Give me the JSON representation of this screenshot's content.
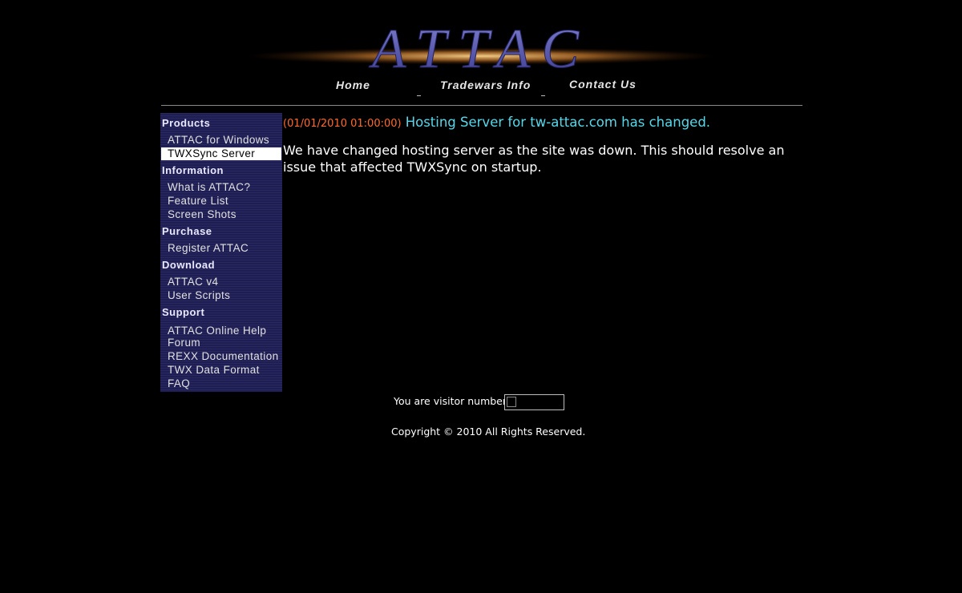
{
  "header": {
    "logo_text": "ATTAC"
  },
  "nav": {
    "home": "Home",
    "tradewars": "Tradewars Info",
    "contact": "Contact Us"
  },
  "sidebar": {
    "sections": [
      {
        "heading": "Products",
        "items": [
          {
            "label": "ATTAC for Windows",
            "active": false
          },
          {
            "label": "TWXSync Server",
            "active": true
          }
        ]
      },
      {
        "heading": "Information",
        "items": [
          {
            "label": "What is ATTAC?"
          },
          {
            "label": "Feature List"
          },
          {
            "label": "Screen Shots"
          }
        ]
      },
      {
        "heading": "Purchase",
        "items": [
          {
            "label": "Register ATTAC"
          }
        ]
      },
      {
        "heading": "Download",
        "items": [
          {
            "label": "ATTAC v4"
          },
          {
            "label": "User Scripts"
          }
        ]
      },
      {
        "heading": "Support",
        "items": [
          {
            "label": "ATTAC Online Help"
          },
          {
            "label": "Forum"
          },
          {
            "label": "REXX Documentation"
          },
          {
            "label": "TWX Data Format"
          },
          {
            "label": "FAQ"
          }
        ]
      }
    ]
  },
  "news": {
    "date": "(01/01/2010 01:00:00)",
    "title": "Hosting Server for tw-attac.com has changed.",
    "body": "We have changed hosting server as the site was down. This should resolve an issue that affected TWXSync on startup."
  },
  "footer": {
    "visitor_label": "You are visitor number",
    "copyright": "Copyright © 2010  All Rights Reserved."
  },
  "colors": {
    "background": "#000000",
    "sidebar_bg": "#1e1e55",
    "date": "#ff6a2a",
    "title": "#56d8ea",
    "logo": "#4a4aa6"
  }
}
